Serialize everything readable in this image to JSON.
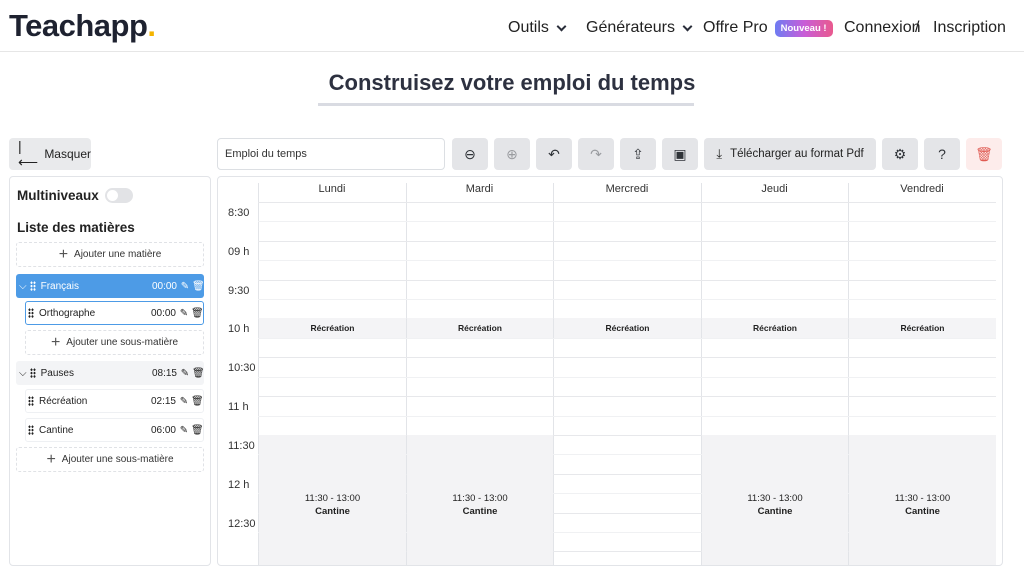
{
  "header": {
    "logo": "Teachapp",
    "logo_dot": ".",
    "nav": {
      "outils": "Outils",
      "generateurs": "Générateurs",
      "offre_pro": "Offre Pro",
      "badge": "Nouveau !",
      "connexion": "Connexion",
      "separator": "/",
      "inscription": "Inscription"
    }
  },
  "page": {
    "title": "Construisez votre emploi du temps"
  },
  "left_panel": {
    "hide_label": "Masquer",
    "multiniveaux_label": "Multiniveaux",
    "multiniveaux_on": false,
    "list_title": "Liste des matières",
    "add_subject": "Ajouter une matière",
    "add_subsubject": "Ajouter une sous-matière",
    "subjects": [
      {
        "name": "Français",
        "time": "00:00",
        "children": [
          {
            "name": "Orthographe",
            "time": "00:00"
          }
        ]
      },
      {
        "name": "Pauses",
        "time": "08:15",
        "children": [
          {
            "name": "Récréation",
            "time": "02:15"
          },
          {
            "name": "Cantine",
            "time": "06:00"
          }
        ]
      }
    ]
  },
  "toolbar": {
    "timetable_name": "Emploi du temps",
    "download_label": "Télécharger au format Pdf",
    "icons": [
      "zoom-out-icon",
      "zoom-in-icon",
      "undo-icon",
      "redo-icon",
      "export-icon",
      "save-icon",
      "download-icon",
      "gear-icon",
      "help-icon",
      "trash-icon"
    ]
  },
  "schedule": {
    "days": [
      "Lundi",
      "Mardi",
      "Mercredi",
      "Jeudi",
      "Vendredi"
    ],
    "time_labels": [
      "8:30",
      "09 h",
      "9:30",
      "10 h",
      "10:30",
      "11 h",
      "11:30",
      "12 h",
      "12:30"
    ],
    "recreation_label": "Récréation",
    "cantine": {
      "time": "11:30 - 13:00",
      "label": "Cantine",
      "days": [
        "Lundi",
        "Mardi",
        "Jeudi",
        "Vendredi"
      ]
    }
  },
  "colors": {
    "accent": "#4d9be6",
    "danger": "#e05a52",
    "logo_dot": "#f4b400"
  }
}
